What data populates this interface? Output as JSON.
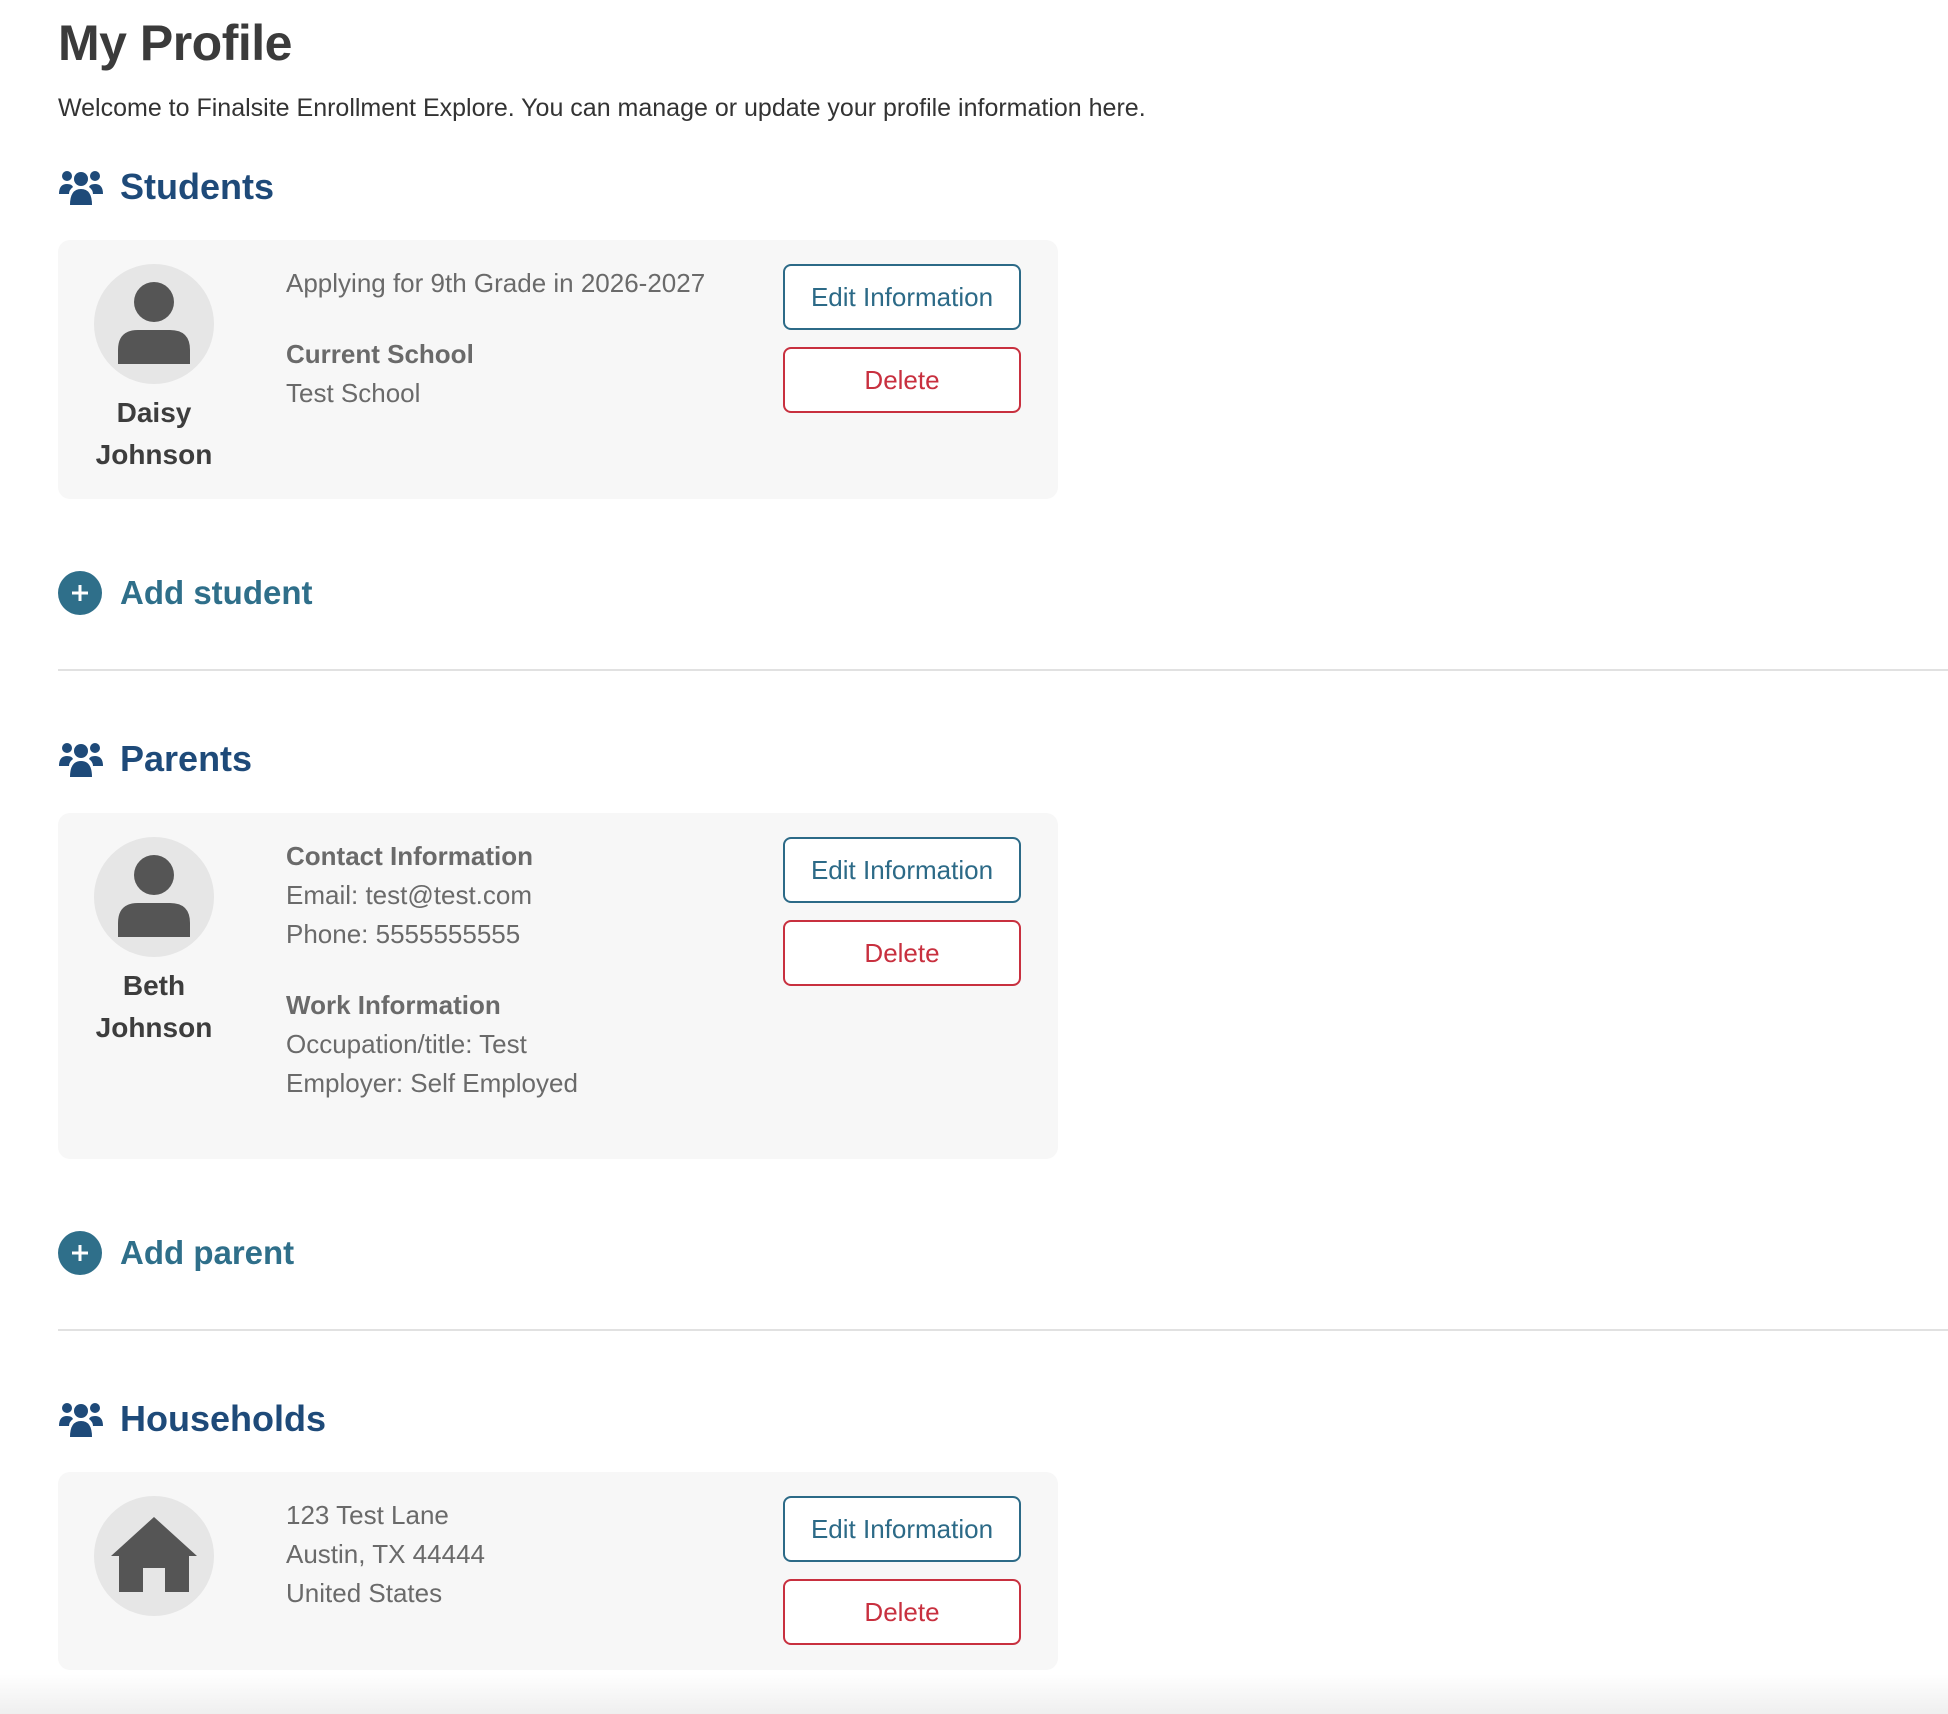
{
  "page": {
    "title": "My Profile",
    "intro": "Welcome to Finalsite Enrollment Explore. You can manage or update your profile information here."
  },
  "students": {
    "heading": "Students",
    "icon": "users-icon",
    "card": {
      "first_name": "Daisy",
      "last_name": "Johnson",
      "applying": "Applying for 9th Grade in 2026-2027",
      "current_school_label": "Current School",
      "current_school": "Test School",
      "edit_label": "Edit Information",
      "delete_label": "Delete"
    },
    "add_label": "Add student"
  },
  "parents": {
    "heading": "Parents",
    "icon": "users-icon",
    "card": {
      "first_name": "Beth",
      "last_name": "Johnson",
      "contact_label": "Contact Information",
      "email": "Email: test@test.com",
      "phone": "Phone: 5555555555",
      "work_label": "Work Information",
      "occupation": "Occupation/title: Test",
      "employer": "Employer: Self Employed",
      "edit_label": "Edit Information",
      "delete_label": "Delete"
    },
    "add_label": "Add parent"
  },
  "households": {
    "heading": "Households",
    "icon": "users-icon",
    "card": {
      "address_line1": "123 Test Lane",
      "address_line2": "Austin, TX 44444",
      "country": "United States",
      "edit_label": "Edit Information",
      "delete_label": "Delete"
    }
  },
  "colors": {
    "heading": "#1e4a79",
    "accent": "#2f6f8a",
    "delete": "#c8303f",
    "card_bg": "#f7f7f7"
  }
}
